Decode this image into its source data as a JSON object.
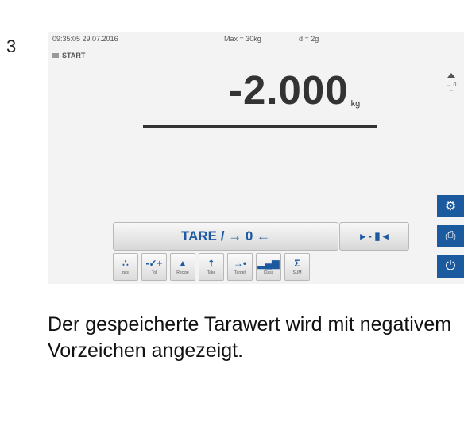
{
  "step": "3",
  "status": {
    "datetime": "09:35:05 29.07.2016",
    "max": "Max = 30kg",
    "d": "d = 2g",
    "mode": "START"
  },
  "display": {
    "value": "-2.000",
    "unit": "kg"
  },
  "indicators": {
    "zero": "→ 0 ←"
  },
  "buttons": {
    "tare": "TARE / → 0 ←",
    "zero": "▸ - ▮ ◂"
  },
  "function_keys": [
    {
      "icon": "∴",
      "label": "pcs"
    },
    {
      "icon": "-✓+",
      "label": "Tol"
    },
    {
      "icon": "▲",
      "label": "Recipe"
    },
    {
      "icon": "⭡",
      "label": "Take"
    },
    {
      "icon": "→•",
      "label": "Target"
    },
    {
      "icon": "▂▄▆",
      "label": "Class"
    },
    {
      "icon": "Σ",
      "label": "SUM"
    }
  ],
  "side_icons": {
    "settings": "⚙",
    "print": "⎙",
    "power": "⏻"
  },
  "caption": "Der gespeicherte Tarawert wird mit negativem Vorzeichen angezeigt."
}
